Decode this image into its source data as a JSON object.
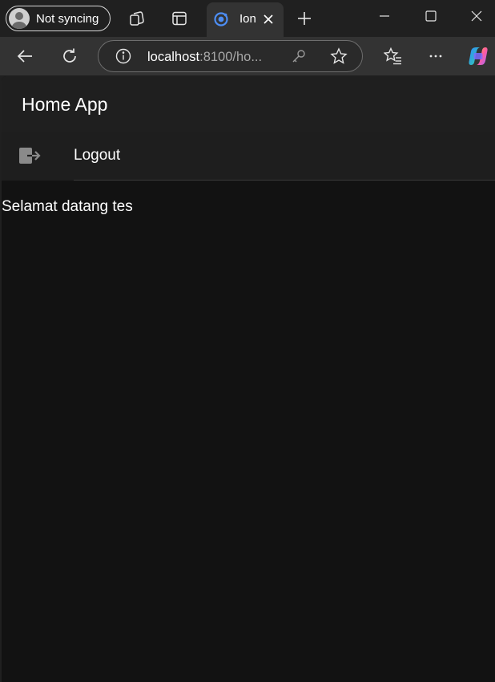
{
  "browser": {
    "profile_label": "Not syncing",
    "tab": {
      "title": "Ion"
    },
    "address": {
      "host": "localhost",
      "rest": ":8100/ho..."
    }
  },
  "app": {
    "title": "Home App",
    "menu": [
      {
        "label": "Logout",
        "icon": "logout-icon"
      }
    ],
    "welcome_text": "Selamat datang tes"
  },
  "colors": {
    "browser_background": "#202020",
    "toolbar": "#333333",
    "page_background": "#121212",
    "header_background": "#1f1f1f",
    "text": "#ffffff",
    "favicon_accent": "#4d8ef5"
  }
}
